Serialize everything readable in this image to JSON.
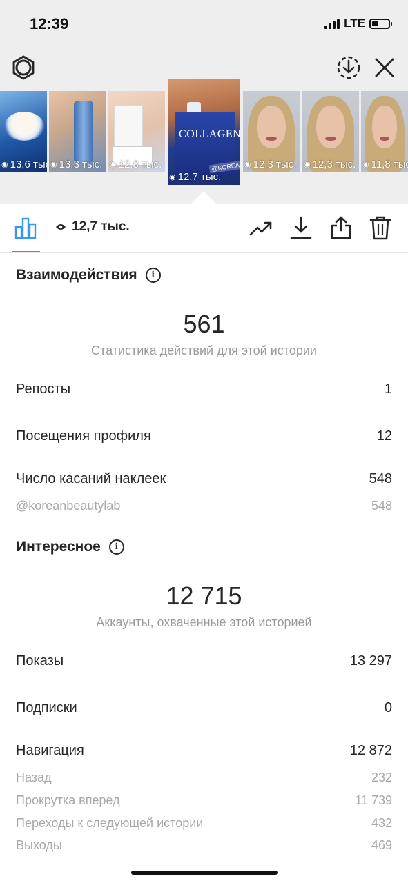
{
  "status_bar": {
    "time": "12:39",
    "network": "LTE"
  },
  "header": {
    "settings_icon": "gear-icon",
    "save_icon": "download-circle-icon",
    "close_icon": "close-icon"
  },
  "stories": [
    {
      "views": "13,6 тыс."
    },
    {
      "views": "13,3 тыс."
    },
    {
      "views": "12,8 тыс."
    },
    {
      "views": "12,7 тыс.",
      "selected": true,
      "brand_text": "COLLAGEN",
      "sticker_text": "@KOREANBEAUTYLAB"
    },
    {
      "views": "12,3 тыс."
    },
    {
      "views": "12,3 тыс."
    },
    {
      "views": "11,8 тыс."
    }
  ],
  "toolbar": {
    "views_total": "12,7 тыс.",
    "accent": "#3897f0",
    "icons": [
      "bar-chart-icon",
      "eye-icon",
      "trend-icon",
      "download-icon",
      "share-icon",
      "trash-icon"
    ]
  },
  "interactions": {
    "title": "Взаимодействия",
    "total": "561",
    "caption": "Статистика действий для этой истории",
    "rows": [
      {
        "label": "Репосты",
        "value": "1"
      },
      {
        "label": "Посещения профиля",
        "value": "12"
      },
      {
        "label": "Число касаний наклеек",
        "value": "548"
      }
    ],
    "sub_rows": [
      {
        "label": "@koreanbeautylab",
        "value": "548"
      }
    ]
  },
  "discovery": {
    "title": "Интересное",
    "total": "12 715",
    "caption": "Аккаунты, охваченные этой историей",
    "rows": [
      {
        "label": "Показы",
        "value": "13 297"
      },
      {
        "label": "Подписки",
        "value": "0"
      },
      {
        "label": "Навигация",
        "value": "12 872"
      }
    ],
    "sub_rows": [
      {
        "label": "Назад",
        "value": "232"
      },
      {
        "label": "Прокрутка вперед",
        "value": "11 739"
      },
      {
        "label": "Переходы к следующей истории",
        "value": "432"
      },
      {
        "label": "Выходы",
        "value": "469"
      }
    ]
  }
}
